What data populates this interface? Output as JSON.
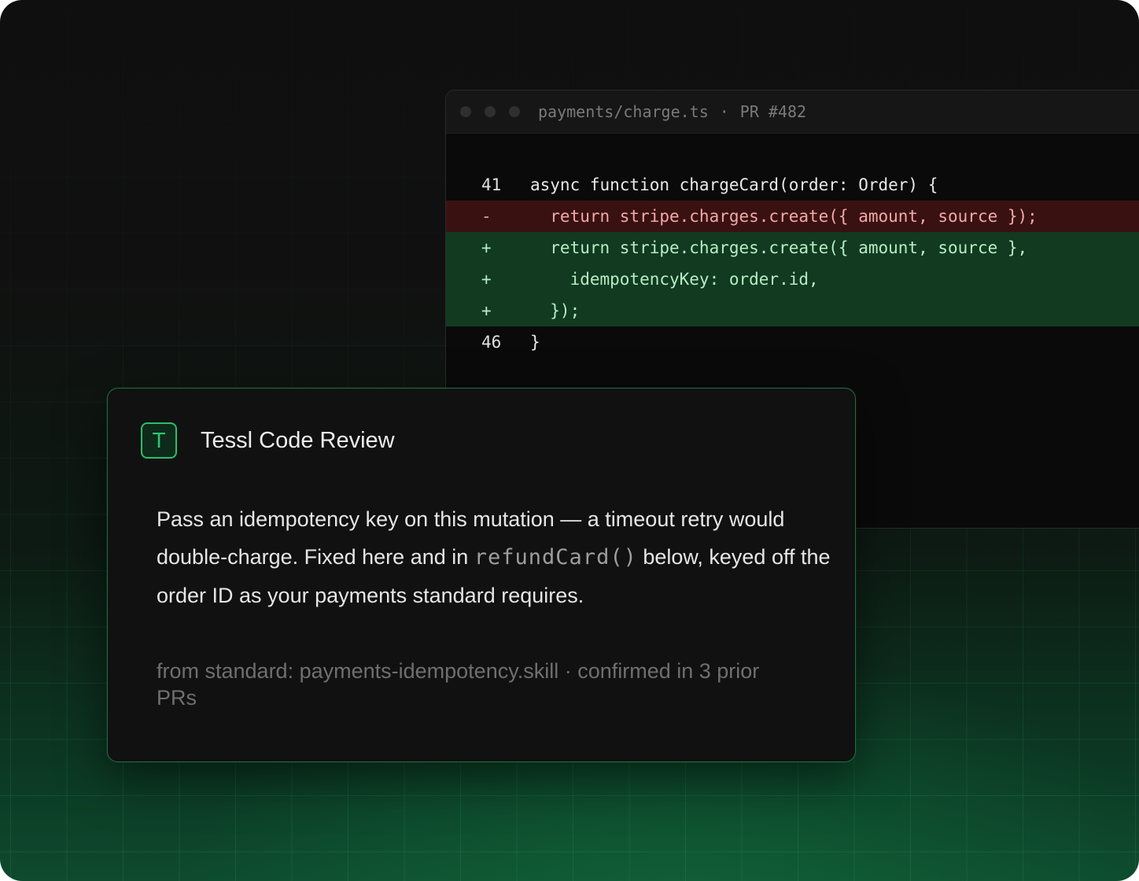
{
  "code_window": {
    "file_path": "payments/charge.ts",
    "separator": "·",
    "pr_label": "PR #482",
    "lines": [
      {
        "gutter": "41",
        "text": "async function chargeCard(order: Order) {",
        "kind": "context"
      },
      {
        "gutter": "-",
        "text": "  return stripe.charges.create({ amount, source });",
        "kind": "removed"
      },
      {
        "gutter": "+",
        "text": "  return stripe.charges.create({ amount, source },",
        "kind": "added"
      },
      {
        "gutter": "+",
        "text": "    idempotencyKey: order.id,",
        "kind": "added"
      },
      {
        "gutter": "+",
        "text": "  });",
        "kind": "added"
      },
      {
        "gutter": "46",
        "text": "}",
        "kind": "context"
      }
    ]
  },
  "review": {
    "logo_letter": "T",
    "title": "Tessl Code Review",
    "message_part1": "Pass an idempotency key on this mutation — a timeout retry would double-charge. Fixed here and in ",
    "message_code": "refundCard()",
    "message_part2": " below, keyed off the order ID as your payments standard requires.",
    "source_note": "from standard: payments-idempotency.skill · confirmed in 3 prior PRs"
  },
  "colors": {
    "accent": "#2dbd6a",
    "removed_bg": "#3a1111",
    "added_bg": "#123a20"
  }
}
